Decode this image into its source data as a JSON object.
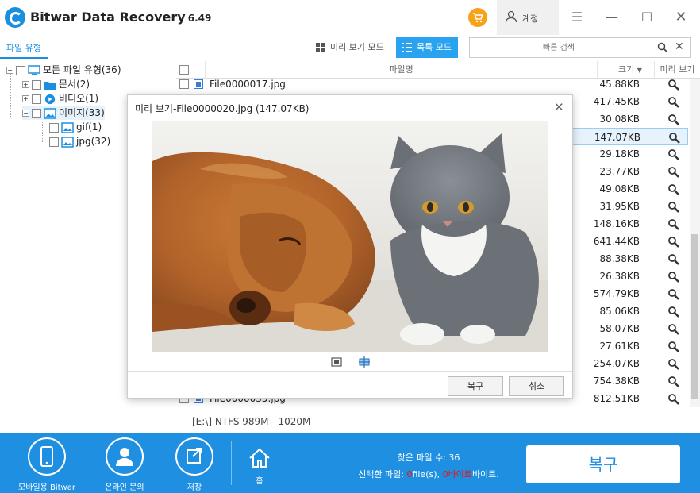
{
  "app": {
    "title": "Bitwar Data Recovery",
    "version": "6.49"
  },
  "titlebar": {
    "account_label": "계정",
    "menu_glyph": "☰",
    "minimize_glyph": "—",
    "maximize_glyph": "☐",
    "close_glyph": "✕"
  },
  "toolbar": {
    "tab_filetype": "파일 유형",
    "view_preview_label": "미리 보기 모드",
    "view_list_label": "목록 모드",
    "search_placeholder": "빠른 검색"
  },
  "tree": {
    "root": {
      "label": "모든 파일 유형(36)"
    },
    "docs": {
      "label": "문서(2)"
    },
    "video": {
      "label": "비디오(1)"
    },
    "image": {
      "label": "이미지(33)"
    },
    "gif": {
      "label": "gif(1)"
    },
    "jpg": {
      "label": "jpg(32)"
    }
  },
  "list": {
    "headers": {
      "name": "파일명",
      "size": "크기",
      "preview": "미리 보기"
    },
    "rows": [
      {
        "name": "File0000017.jpg",
        "size": "45.88KB"
      },
      {
        "name": "",
        "size": "417.45KB"
      },
      {
        "name": "",
        "size": "30.08KB"
      },
      {
        "name": "",
        "size": "147.07KB"
      },
      {
        "name": "",
        "size": "29.18KB"
      },
      {
        "name": "",
        "size": "23.77KB"
      },
      {
        "name": "",
        "size": "49.08KB"
      },
      {
        "name": "",
        "size": "31.95KB"
      },
      {
        "name": "",
        "size": "148.16KB"
      },
      {
        "name": "",
        "size": "641.44KB"
      },
      {
        "name": "",
        "size": "88.38KB"
      },
      {
        "name": "",
        "size": "26.38KB"
      },
      {
        "name": "",
        "size": "574.79KB"
      },
      {
        "name": "",
        "size": "85.06KB"
      },
      {
        "name": "",
        "size": "58.07KB"
      },
      {
        "name": "",
        "size": "27.61KB"
      },
      {
        "name": "",
        "size": "254.07KB"
      },
      {
        "name": "",
        "size": "754.38KB"
      },
      {
        "name": "File0000035.jpg",
        "size": "812.51KB"
      }
    ],
    "selected_index": 3
  },
  "status": {
    "path": "[E:\\] NTFS 989M - 1020M"
  },
  "dialog": {
    "title": "미리 보기-File0000020.jpg (147.07KB)",
    "recover_label": "복구",
    "cancel_label": "취소"
  },
  "bottom": {
    "mobile_label": "모바일용 Bitwar",
    "support_label": "온라인 문의",
    "save_label": "저장",
    "home_label": "홈",
    "found_label": "찾은 파일 수: 36",
    "selected_prefix": "선택한 파일: ",
    "selected_files_count": "0",
    "selected_files_unit": "file(s), ",
    "selected_bytes_count": "0",
    "selected_bytes_word": "바이트",
    "selected_suffix": "바이트.",
    "recover_big": "복구"
  },
  "colors": {
    "accent": "#1e8fe1",
    "list_mode_bg": "#29a3f0",
    "cart": "#f7a21b"
  },
  "icons": [
    "app-logo-icon",
    "cart-icon",
    "account-icon",
    "menu-icon",
    "grid-icon",
    "list-icon",
    "search-icon",
    "close-icon",
    "folder-icon",
    "video-icon",
    "image-icon",
    "magnifier-icon",
    "zoom-fit-icon",
    "zoom-actual-icon",
    "phone-icon",
    "user-support-icon",
    "save-icon",
    "home-icon"
  ]
}
